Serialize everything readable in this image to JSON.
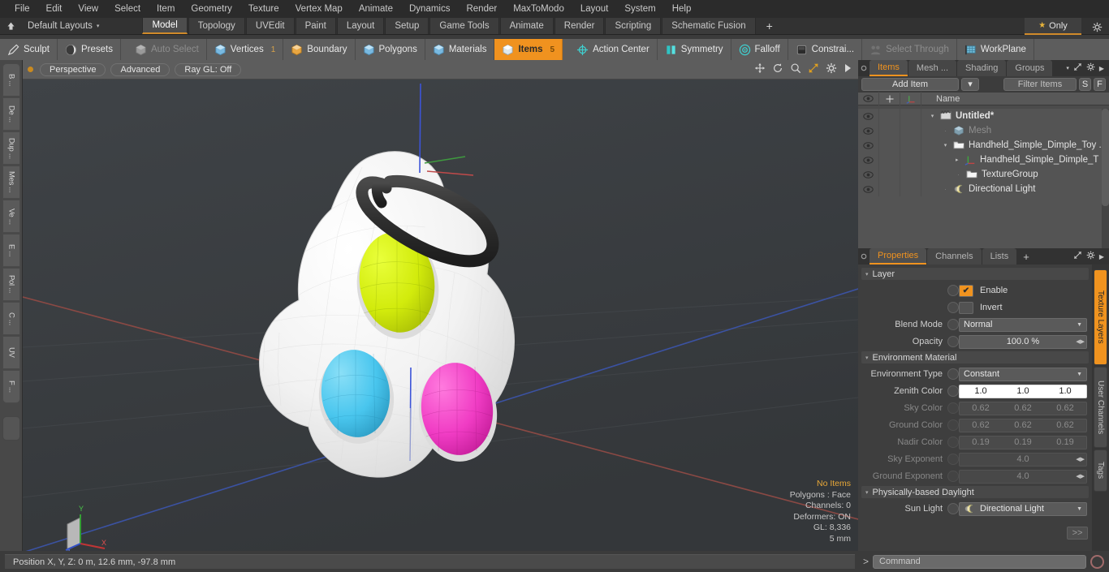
{
  "menubar": {
    "items": [
      "File",
      "Edit",
      "View",
      "Select",
      "Item",
      "Geometry",
      "Texture",
      "Vertex Map",
      "Animate",
      "Dynamics",
      "Render",
      "MaxToModo",
      "Layout",
      "System",
      "Help"
    ]
  },
  "layoutbar": {
    "home_icon": "home-icon",
    "dropdown_label": "Default Layouts",
    "dropdown_carat": "▾",
    "tabs": [
      {
        "label": "Model",
        "active": true
      },
      {
        "label": "Topology",
        "active": false
      },
      {
        "label": "UVEdit",
        "active": false
      },
      {
        "label": "Paint",
        "active": false
      },
      {
        "label": "Layout",
        "active": false
      },
      {
        "label": "Setup",
        "active": false
      },
      {
        "label": "Game Tools",
        "active": false
      },
      {
        "label": "Animate",
        "active": false
      },
      {
        "label": "Render",
        "active": false
      },
      {
        "label": "Scripting",
        "active": false
      },
      {
        "label": "Schematic Fusion",
        "active": false
      }
    ],
    "add_tab": "+",
    "only_button": {
      "label": "Only",
      "star": "★"
    },
    "gear_icon": "gear-icon",
    "accent": "#d08a2a"
  },
  "modebar": {
    "left_group": [
      {
        "label": "Sculpt",
        "icon": "pencil-icon",
        "state": "normal"
      },
      {
        "label": "Presets",
        "icon": "sphere-icon",
        "state": "normal"
      }
    ],
    "select_group": [
      {
        "label": "Auto Select",
        "icon": "cube-grey-icon",
        "state": "dim",
        "count": ""
      },
      {
        "label": "Vertices",
        "icon": "cube-blue-icon",
        "state": "normal",
        "count": "1"
      },
      {
        "label": "Boundary",
        "icon": "cube-orange-icon",
        "state": "normal",
        "count": ""
      },
      {
        "label": "Polygons",
        "icon": "cube-blue-icon",
        "state": "normal",
        "count": ""
      },
      {
        "label": "Materials",
        "icon": "cube-blue-icon",
        "state": "normal",
        "count": ""
      },
      {
        "label": "Items",
        "icon": "cube-white-icon",
        "state": "selected",
        "count": "5"
      }
    ],
    "right_group": [
      {
        "label": "Action Center",
        "icon": "crosshair-icon",
        "state": "normal"
      },
      {
        "label": "Symmetry",
        "icon": "mirror-icon",
        "state": "normal"
      },
      {
        "label": "Falloff",
        "icon": "target-icon",
        "state": "normal"
      },
      {
        "label": "Constrai...",
        "icon": "constraint-icon",
        "state": "normal"
      },
      {
        "label": "Select Through",
        "icon": "select-through-icon",
        "state": "dim"
      },
      {
        "label": "WorkPlane",
        "icon": "workplane-icon",
        "state": "normal"
      }
    ],
    "selected_color": "#f0921f"
  },
  "left_strip": {
    "tabs": [
      "B ...",
      "De ...",
      "Dup ...",
      "Mes ...",
      "Ve ...",
      "E ...",
      "Pol ...",
      "C ...",
      "UV",
      "F ..."
    ]
  },
  "viewport": {
    "header": {
      "dot": "viewport-dot",
      "buttons": [
        "Perspective",
        "Advanced",
        "Ray GL: Off"
      ],
      "icons": [
        "move-icon",
        "rotate-icon",
        "zoom-icon",
        "maximize-icon",
        "gear-icon",
        "play-icon"
      ]
    },
    "stats": [
      "No Items",
      "Polygons : Face",
      "Channels: 0",
      "Deformers: ON",
      "GL: 8,336",
      "5 mm"
    ],
    "stats_accent": "#e8a838",
    "background": "#3a3d40",
    "axis_gizmo": {
      "x": "X",
      "y": "Y",
      "z": "Z"
    },
    "model": {
      "name": "handheld-dimple-toy",
      "body_color": "#f5f5f5",
      "ring_color": "#2f2f2f",
      "bubbles": [
        {
          "name": "bubble-yellow",
          "color": "#d4ec10"
        },
        {
          "name": "bubble-cyan",
          "color": "#4cc8ee"
        },
        {
          "name": "bubble-magenta",
          "color": "#f03cc4"
        }
      ]
    }
  },
  "items_panel": {
    "tabs": [
      {
        "label": "Items",
        "active": true
      },
      {
        "label": "Mesh ...",
        "active": false
      },
      {
        "label": "Shading",
        "active": false
      },
      {
        "label": "Groups",
        "active": false
      }
    ],
    "tab_plus": "",
    "tab_icons": [
      "chevron-down-icon",
      "maximize-icon",
      "gear-icon",
      "play-icon"
    ],
    "toolbar": {
      "add_item": "Add Item",
      "add_item_arrow": "▾",
      "filter_items": "Filter Items",
      "s_button": "S",
      "f_button": "F"
    },
    "columns": {
      "eye": "eye-icon",
      "lock": "move-icon",
      "axis": "axis-icon",
      "name": "Name"
    },
    "rows": [
      {
        "label": "Untitled*",
        "icon": "scene-icon",
        "indent": 0,
        "twisty": "▾",
        "bold": true,
        "dim": false
      },
      {
        "label": "Mesh",
        "icon": "mesh-cube-icon",
        "indent": 1,
        "twisty": "",
        "bold": false,
        "dim": true
      },
      {
        "label": "Handheld_Simple_Dimple_Toy ...",
        "icon": "group-icon",
        "indent": 1,
        "twisty": "▾",
        "bold": false,
        "dim": false
      },
      {
        "label": "Handheld_Simple_Dimple_T ...",
        "icon": "locator-icon",
        "indent": 2,
        "twisty": "▸",
        "bold": false,
        "dim": false
      },
      {
        "label": "TextureGroup",
        "icon": "group-icon",
        "indent": 2,
        "twisty": "",
        "bold": false,
        "dim": false
      },
      {
        "label": "Directional Light",
        "icon": "light-icon",
        "indent": 1,
        "twisty": "",
        "bold": false,
        "dim": false
      }
    ]
  },
  "properties_panel": {
    "tabs": [
      {
        "label": "Properties",
        "active": true
      },
      {
        "label": "Channels",
        "active": false
      },
      {
        "label": "Lists",
        "active": false
      },
      {
        "label": "+",
        "active": false
      }
    ],
    "tab_icons": [
      "maximize-icon",
      "gear-icon",
      "play-icon"
    ],
    "sections": [
      {
        "name": "Layer",
        "title": "Layer",
        "rows": [
          {
            "type": "checkbox",
            "label": "",
            "checked": true,
            "text": "Enable",
            "dim": false
          },
          {
            "type": "checkbox",
            "label": "",
            "checked": false,
            "text": "Invert",
            "dim": false
          },
          {
            "type": "dropdown",
            "label": "Blend Mode",
            "value": "Normal",
            "dim": false
          },
          {
            "type": "spinner",
            "label": "Opacity",
            "value": "100.0 %",
            "dim": false
          }
        ]
      },
      {
        "name": "Environment Material",
        "title": "Environment Material",
        "rows": [
          {
            "type": "dropdown",
            "label": "Environment Type",
            "value": "Constant",
            "dim": false
          },
          {
            "type": "triple",
            "label": "Zenith Color",
            "values": [
              "1.0",
              "1.0",
              "1.0"
            ],
            "dim": false,
            "white": true
          },
          {
            "type": "triple",
            "label": "Sky Color",
            "values": [
              "0.62",
              "0.62",
              "0.62"
            ],
            "dim": true,
            "white": false
          },
          {
            "type": "triple",
            "label": "Ground Color",
            "values": [
              "0.62",
              "0.62",
              "0.62"
            ],
            "dim": true,
            "white": false
          },
          {
            "type": "triple",
            "label": "Nadir Color",
            "values": [
              "0.19",
              "0.19",
              "0.19"
            ],
            "dim": true,
            "white": false
          },
          {
            "type": "spinner",
            "label": "Sky Exponent",
            "value": "4.0",
            "dim": true
          },
          {
            "type": "spinner",
            "label": "Ground Exponent",
            "value": "4.0",
            "dim": true
          }
        ]
      },
      {
        "name": "Physically-based Daylight",
        "title": "Physically-based Daylight",
        "rows": [
          {
            "type": "dropdown-icon",
            "label": "Sun Light",
            "value": "Directional Light",
            "dim": false,
            "icon": "light-icon"
          }
        ]
      }
    ],
    "go_button": ">>",
    "vertical_tabs": [
      {
        "label": "Texture Layers",
        "active": true
      },
      {
        "label": "User Channels",
        "active": false
      },
      {
        "label": "Tags",
        "active": false
      }
    ]
  },
  "statusbar": {
    "text": "Position X, Y, Z:   0 m, 12.6 mm, -97.8 mm"
  },
  "command_bar": {
    "prompt": ">",
    "placeholder": "Command",
    "record_icon": "record-circle-icon"
  }
}
